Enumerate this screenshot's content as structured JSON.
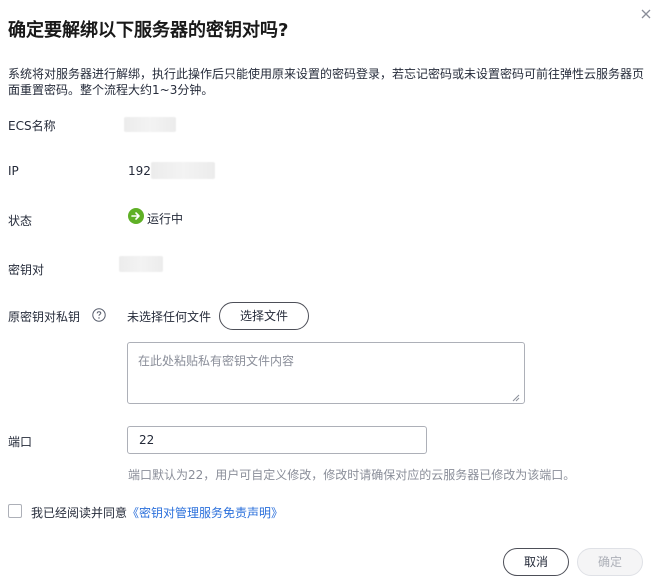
{
  "dialog": {
    "title": "确定要解绑以下服务器的密钥对吗?",
    "description": "系统将对服务器进行解绑，执行此操作后只能使用原来设置的密码登录，若忘记密码或未设置密码可前往弹性云服务器页面重置密码。整个流程大约1~3分钟。",
    "close_icon": "close-icon"
  },
  "fields": {
    "ecs_name_label": "ECS名称",
    "ip_label": "IP",
    "ip_value_prefix": "192.",
    "status_label": "状态",
    "status_value": "运行中",
    "status_icon": "arrow-right-circle-icon",
    "status_color": "#5fb026",
    "keypair_label": "密钥对",
    "private_key_label": "原密钥对私钥",
    "help_icon": "question-circle-icon",
    "no_file_text": "未选择任何文件",
    "choose_file_label": "选择文件",
    "private_key_placeholder": "在此处粘贴私有密钥文件内容",
    "port_label": "端口",
    "port_value": "22",
    "port_hint": "端口默认为22，用户可自定义修改，修改时请确保对应的云服务器已修改为该端口。"
  },
  "agreement": {
    "text": "我已经阅读并同意",
    "link": "《密钥对管理服务免责声明》",
    "link_color": "#2a6fdb"
  },
  "footer": {
    "cancel_label": "取消",
    "confirm_label": "确定"
  }
}
